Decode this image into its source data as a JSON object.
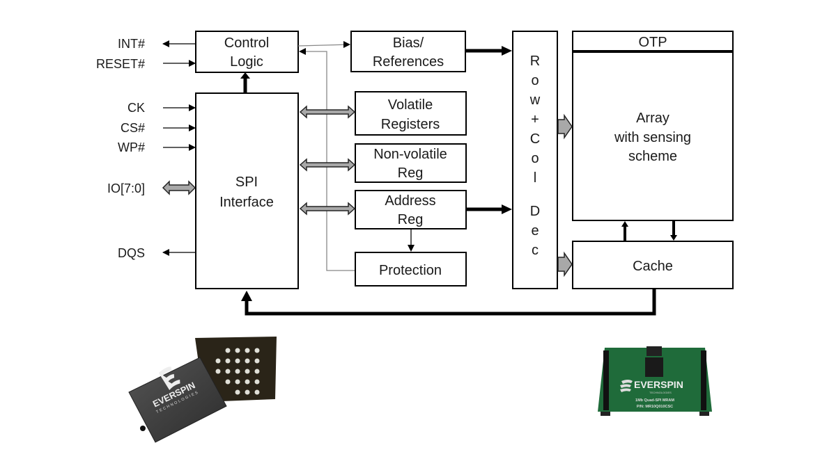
{
  "diagram": {
    "signals": {
      "int": "INT#",
      "reset": "RESET#",
      "ck": "CK",
      "cs": "CS#",
      "wp": "WP#",
      "io": "IO[7:0]",
      "dqs": "DQS"
    },
    "blocks": {
      "control_logic": [
        "Control",
        "Logic"
      ],
      "spi_interface": [
        "SPI",
        "Interface"
      ],
      "bias": [
        "Bias/",
        "References"
      ],
      "volatile_registers": [
        "Volatile",
        "Registers"
      ],
      "nonvolatile_reg": [
        "Non-volatile",
        "Reg"
      ],
      "address_reg": [
        "Address",
        "Reg"
      ],
      "protection": "Protection",
      "row_col_dec": [
        "R",
        "o",
        "w",
        "+",
        "C",
        "o",
        "l",
        "",
        "D",
        "e",
        "c"
      ],
      "otp": "OTP",
      "array": [
        "Array",
        "with sensing",
        "scheme"
      ],
      "cache": "Cache"
    }
  },
  "photos": {
    "chip": {
      "brand": "EVERSPIN",
      "sub": "TECHNOLOGIES"
    },
    "board": {
      "brand": "EVERSPIN",
      "sub": "TECHNOLOGIES",
      "line1": "1Mb Quad-SPI MRAM",
      "line2": "P/N: MR10Q010CSC"
    }
  },
  "colors": {
    "board_green": "#1f6b3a",
    "chip_dark": "#3a3a3a",
    "arrow_fill": "#a8a8a8"
  }
}
